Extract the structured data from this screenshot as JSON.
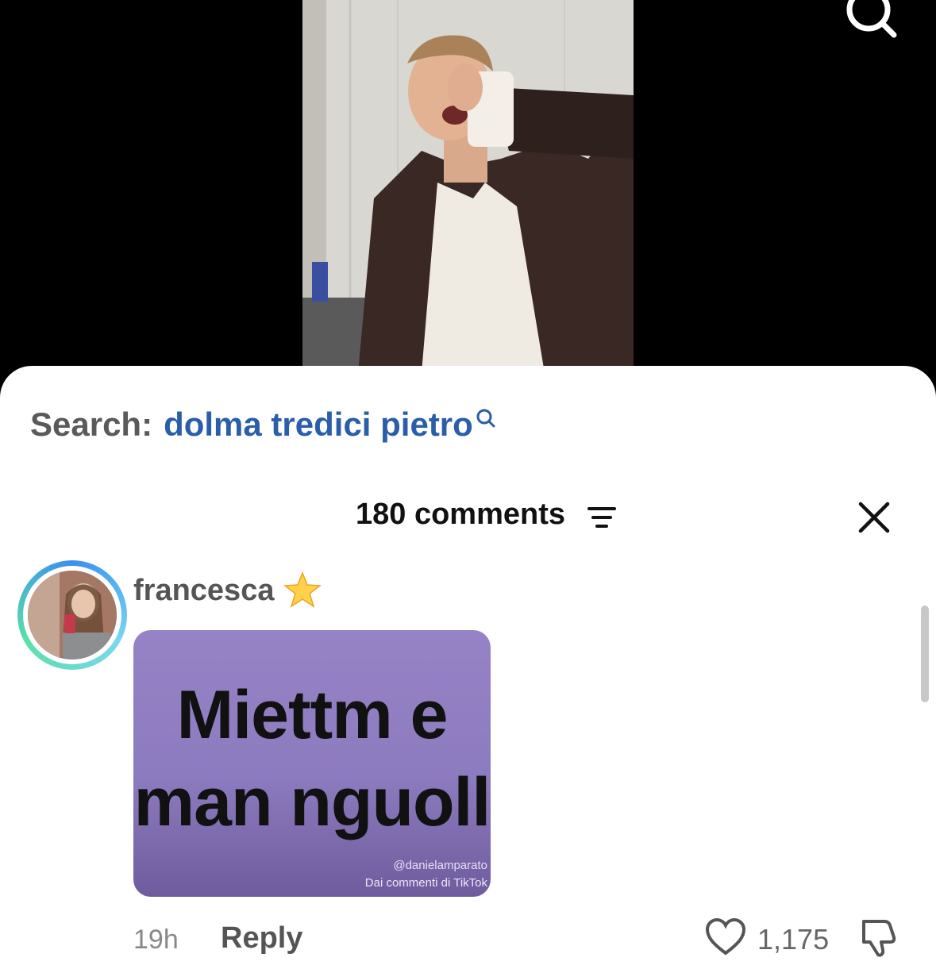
{
  "search": {
    "prefix": "Search:",
    "query": "dolma tredici pietro"
  },
  "comments_header": {
    "count_label": "180 comments"
  },
  "comment": {
    "username": "francesca",
    "sticker_line1": "Miettm e",
    "sticker_line2": "man nguoll",
    "watermark_user": "@danielamparato",
    "watermark_source": "Dai commenti di TikTok",
    "time": "19h",
    "reply_label": "Reply",
    "likes": "1,175"
  },
  "icons": {
    "top_search": "search-icon",
    "query_search": "search-icon",
    "filter": "filter-icon",
    "close": "close-icon",
    "star": "star-icon",
    "heart": "heart-icon",
    "dislike": "dislike-icon"
  },
  "colors": {
    "query": "#2b5ea8",
    "sticker_bg": "#9683c6"
  }
}
